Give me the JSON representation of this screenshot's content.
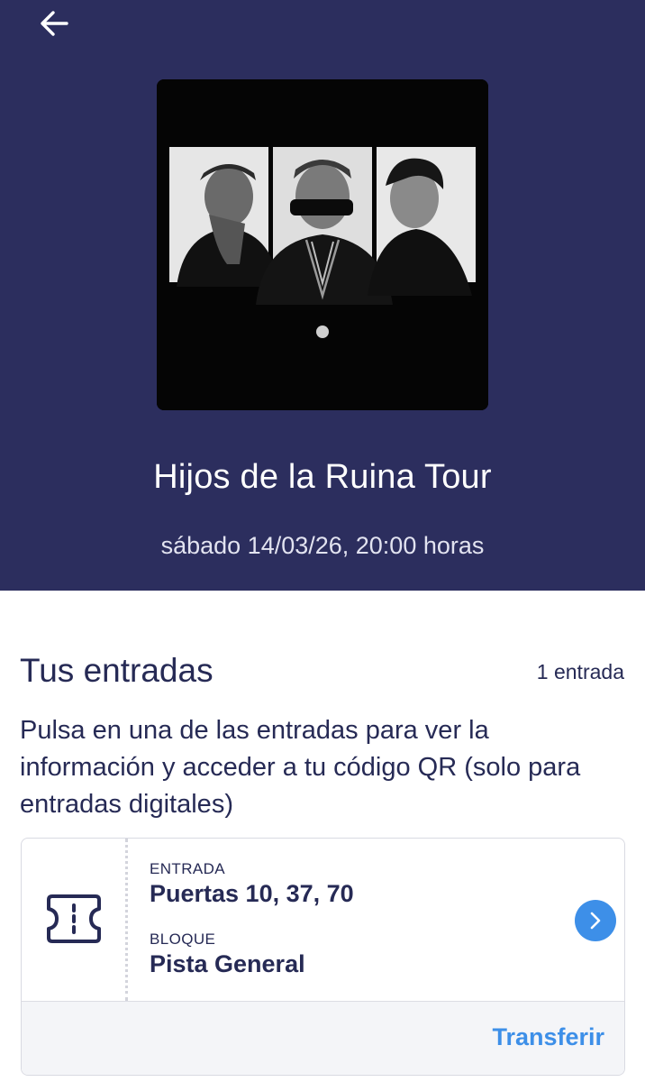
{
  "header": {
    "back_icon": "arrow-left-icon",
    "background_color": "#2c2e5e",
    "event_title": "Hijos de la Ruina Tour",
    "event_date": "sábado 14/03/26, 20:00 horas",
    "artwork": "event-artwork-image"
  },
  "tickets_section": {
    "title": "Tus entradas",
    "count": "1 entrada",
    "instructions": "Pulsa en una de las entradas para ver la información y acceder a tu código QR (solo para entradas digitales)"
  },
  "ticket": {
    "icon": "ticket-icon",
    "entry_label": "ENTRADA",
    "entry_value": "Puertas 10, 37, 70",
    "block_label": "BLOQUE",
    "block_value": "Pista General",
    "chevron_icon": "chevron-right-icon",
    "transfer_label": "Transferir"
  },
  "colors": {
    "accent": "#3d8fe8",
    "text_primary": "#262a55"
  }
}
